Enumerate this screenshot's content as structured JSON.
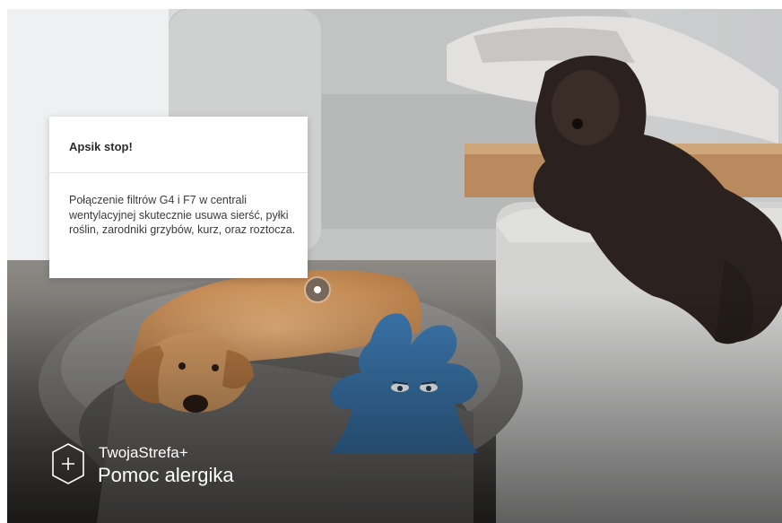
{
  "tooltip": {
    "title": "Apsik stop!",
    "body": "Połączenie filtrów G4 i F7 w centrali wentylacyjnej skutecznie usuwa sierść, pyłki roślin, zarodniki grzybów, kurz, oraz roztocza."
  },
  "brand": {
    "subtitle": "TwojaStrefa+",
    "title": "Pomoc alergika",
    "icon": "shield-plus-icon"
  },
  "colors": {
    "mascot": "#3b76ad",
    "tooltip_bg": "#ffffff"
  }
}
